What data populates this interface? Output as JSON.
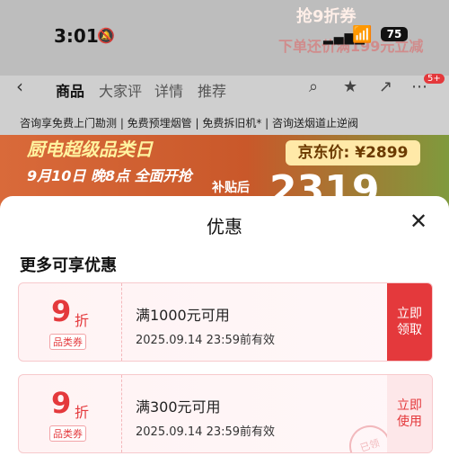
{
  "status": {
    "time": "3:01",
    "battery": "75"
  },
  "background": {
    "promo_top": "抢9折券",
    "promo_top2": "下单还价满199元立减",
    "nav_tabs": [
      "商品",
      "大家评",
      "详情",
      "推荐"
    ],
    "nav_badge": "5+",
    "services": "咨询享免费上门勘测 | 免费预埋烟管 | 免费拆旧机* | 咨询送烟道止逆阀",
    "banner_title": "厨电超级品类日",
    "banner_sub": "9月10日 晚8点 全面开抢",
    "price_box": "京东价: ¥2899",
    "sub_price": "补贴后",
    "big_price": "2319"
  },
  "sheet": {
    "title": "优惠",
    "section": "更多可享优惠"
  },
  "coupons": [
    {
      "discount": "9",
      "unit": "折",
      "tag": "品类券",
      "condition": "满1000元可用",
      "expires": "2025.09.14 23:59前有效",
      "button": "立即\n领取"
    },
    {
      "discount": "9",
      "unit": "折",
      "tag": "品类券",
      "condition": "满300元可用",
      "expires": "2025.09.14 23:59前有效",
      "button": "立即\n使用",
      "stamp": "已领"
    }
  ],
  "colors": {
    "accent": "#e4393c",
    "coupon_bg": "#fff3f4"
  },
  "icons": [
    "bell-slash-icon",
    "signal-icon",
    "wifi-icon",
    "back-icon",
    "search-icon",
    "star-icon",
    "share-icon",
    "more-icon",
    "close-icon"
  ]
}
